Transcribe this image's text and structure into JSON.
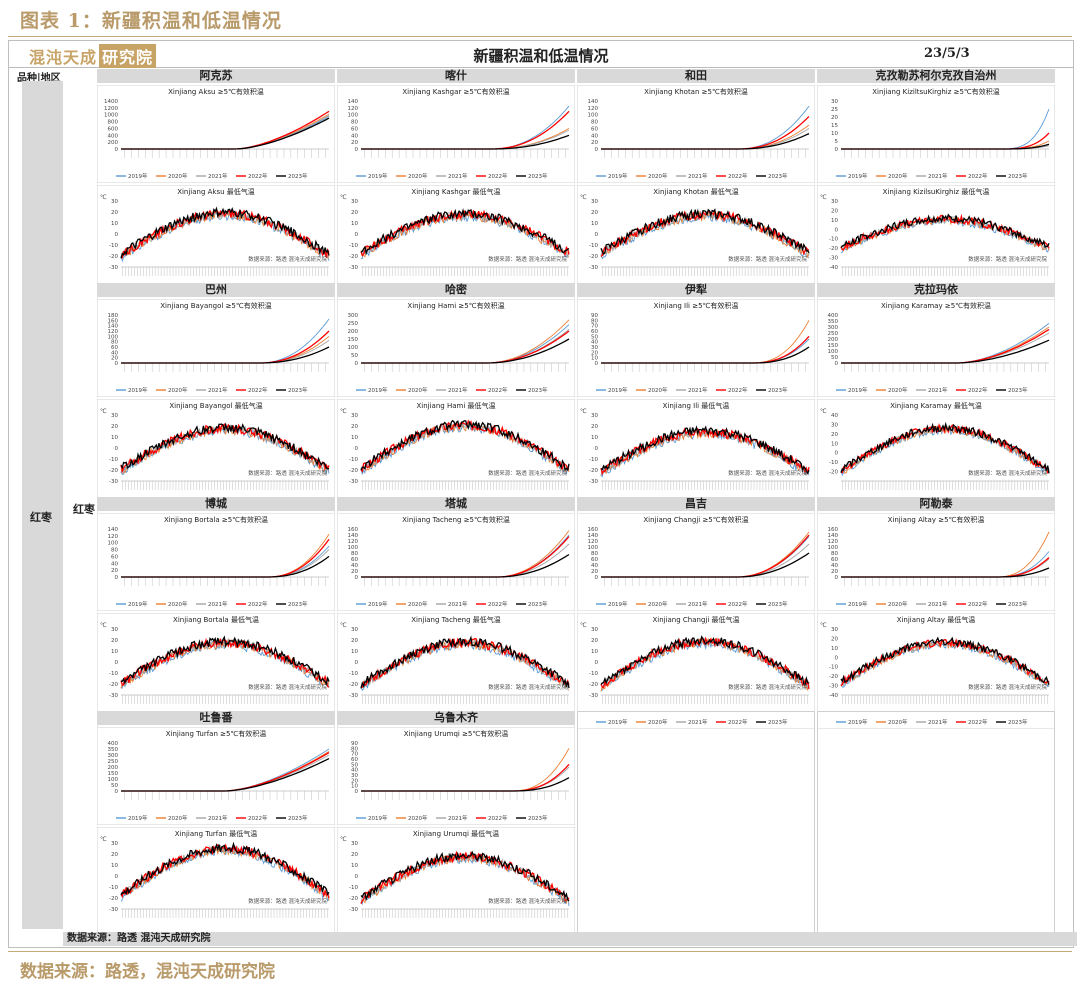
{
  "figure_caption": "图表 1：新疆积温和低温情况",
  "header": {
    "logo_text": "混沌天成",
    "logo_box": "研究院",
    "title": "新疆积温和低温情况",
    "date": "23/5/3",
    "col_header": "品种|地区"
  },
  "left_label": "红枣",
  "left_label2": "红枣",
  "regions": [
    "阿克苏",
    "喀什",
    "和田",
    "克孜勒苏柯尔克孜自治州",
    "巴州",
    "哈密",
    "伊犁",
    "克拉玛依",
    "博城",
    "塔城",
    "昌吉",
    "阿勒泰",
    "吐鲁番",
    "乌鲁木齐"
  ],
  "footer": "数据来源：路透  混沌天成研究院",
  "source_note": "数据来源：路透，混沌天成研究院",
  "colors": {
    "y2019": "#5b9bd5",
    "y2020": "#ed7d31",
    "y2021": "#a5a5a5",
    "y2022": "#ff0000",
    "y2023": "#000000"
  },
  "chart_data": [
    {
      "type": "line",
      "region": "阿克苏",
      "title": "Xinjiang  Aksu  ≥5℃有效积温",
      "y_ticks": [
        "0",
        "200",
        "400",
        "600",
        "800",
        "1000",
        "1200",
        "1400"
      ],
      "ylim": [
        0,
        1400
      ],
      "series": [
        {
          "name": "2019年",
          "end": 950
        },
        {
          "name": "2020年",
          "end": 1020
        },
        {
          "name": "2021年",
          "end": 980
        },
        {
          "name": "2022年",
          "end": 1100
        },
        {
          "name": "2023年",
          "end": 900
        }
      ],
      "start": 0.55,
      "growth": 1.6
    },
    {
      "type": "line",
      "region": "阿克苏",
      "title": "Xinjiang Aksu 最低气温",
      "y_ticks": [
        "-30",
        "-20",
        "-10",
        "0",
        "10",
        "20",
        "30"
      ],
      "ylim": [
        -30,
        30
      ],
      "unit": "℃",
      "note": "数据来源：路透  混沌天成研究院",
      "series": [
        {
          "name": "2019年"
        },
        {
          "name": "2020年"
        },
        {
          "name": "2021年"
        },
        {
          "name": "2022年"
        },
        {
          "name": "2023年"
        }
      ],
      "amp": [
        -20,
        18
      ]
    },
    {
      "type": "line",
      "region": "喀什",
      "title": "Xinjiang  Kashgar  ≥5℃有效积温",
      "y_ticks": [
        "0",
        "20",
        "40",
        "60",
        "80",
        "100",
        "120",
        "140"
      ],
      "ylim": [
        0,
        140
      ],
      "series": [
        {
          "name": "2019年",
          "end": 125
        },
        {
          "name": "2020年",
          "end": 60
        },
        {
          "name": "2021年",
          "end": 55
        },
        {
          "name": "2022年",
          "end": 110
        },
        {
          "name": "2023年",
          "end": 40
        }
      ],
      "start": 0.62,
      "growth": 2.2
    },
    {
      "type": "line",
      "region": "喀什",
      "title": "Xinjiang Kashgar 最低气温",
      "y_ticks": [
        "-30",
        "-20",
        "-10",
        "0",
        "10",
        "20",
        "30"
      ],
      "ylim": [
        -30,
        30
      ],
      "unit": "℃",
      "note": "数据来源：路透  混沌天成研究院",
      "series": [
        {
          "name": "2019年"
        },
        {
          "name": "2020年"
        },
        {
          "name": "2021年"
        },
        {
          "name": "2022年"
        },
        {
          "name": "2023年"
        }
      ],
      "amp": [
        -18,
        17
      ]
    },
    {
      "type": "line",
      "region": "和田",
      "title": "Xinjiang  Khotan  ≥5℃有效积温",
      "y_ticks": [
        "0",
        "20",
        "40",
        "60",
        "80",
        "100",
        "120",
        "140"
      ],
      "ylim": [
        0,
        140
      ],
      "series": [
        {
          "name": "2019年",
          "end": 125
        },
        {
          "name": "2020年",
          "end": 70
        },
        {
          "name": "2021年",
          "end": 60
        },
        {
          "name": "2022年",
          "end": 95
        },
        {
          "name": "2023年",
          "end": 45
        }
      ],
      "start": 0.65,
      "growth": 2.3
    },
    {
      "type": "line",
      "region": "和田",
      "title": "Xinjiang Khotan 最低气温",
      "y_ticks": [
        "-30",
        "-20",
        "-10",
        "0",
        "10",
        "20",
        "30"
      ],
      "ylim": [
        -30,
        30
      ],
      "unit": "℃",
      "note": "数据来源：路透  混沌天成研究院",
      "series": [
        {
          "name": "2019年"
        },
        {
          "name": "2020年"
        },
        {
          "name": "2021年"
        },
        {
          "name": "2022年"
        },
        {
          "name": "2023年"
        }
      ],
      "amp": [
        -18,
        17
      ]
    },
    {
      "type": "line",
      "region": "克孜勒苏柯尔克孜自治州",
      "title": "Xinjiang KiziltsuKirghiz ≥5℃有效积温",
      "y_ticks": [
        "0",
        "5",
        "10",
        "15",
        "20",
        "25",
        "30"
      ],
      "ylim": [
        0,
        30
      ],
      "series": [
        {
          "name": "2019年",
          "end": 25
        },
        {
          "name": "2020年",
          "end": 5
        },
        {
          "name": "2021年",
          "end": 2
        },
        {
          "name": "2022年",
          "end": 10
        },
        {
          "name": "2023年",
          "end": 3
        }
      ],
      "start": 0.75,
      "growth": 3.5
    },
    {
      "type": "line",
      "region": "克孜勒苏柯尔克孜自治州",
      "title": "Xinjiang KizilsuKirghiz 最低气温",
      "y_ticks": [
        "-40",
        "-30",
        "-20",
        "-10",
        "0",
        "10",
        "20",
        "30"
      ],
      "ylim": [
        -40,
        30
      ],
      "unit": "℃",
      "note": "数据来源：路透  混沌天成研究院",
      "series": [
        {
          "name": "2019年"
        },
        {
          "name": "2020年"
        },
        {
          "name": "2021年"
        },
        {
          "name": "2022年"
        },
        {
          "name": "2023年"
        }
      ],
      "amp": [
        -20,
        10
      ]
    },
    {
      "type": "line",
      "region": "巴州",
      "title": "Xinjiang  Bayangol  ≥5℃有效积温",
      "y_ticks": [
        "0",
        "20",
        "40",
        "60",
        "80",
        "100",
        "120",
        "140",
        "160",
        "180"
      ],
      "ylim": [
        0,
        180
      ],
      "series": [
        {
          "name": "2019年",
          "end": 165
        },
        {
          "name": "2020年",
          "end": 100
        },
        {
          "name": "2021年",
          "end": 85
        },
        {
          "name": "2022年",
          "end": 120
        },
        {
          "name": "2023年",
          "end": 60
        }
      ],
      "start": 0.66,
      "growth": 2.2
    },
    {
      "type": "line",
      "region": "巴州",
      "title": "Xinjiang Bayangol 最低气温",
      "y_ticks": [
        "-30",
        "-20",
        "-10",
        "0",
        "10",
        "20",
        "30"
      ],
      "ylim": [
        -30,
        30
      ],
      "unit": "℃",
      "note": "数据来源：路透  混沌天成研究院",
      "series": [
        {
          "name": "2019年"
        },
        {
          "name": "2020年"
        },
        {
          "name": "2021年"
        },
        {
          "name": "2022年"
        },
        {
          "name": "2023年"
        }
      ],
      "amp": [
        -20,
        17
      ]
    },
    {
      "type": "line",
      "region": "哈密",
      "title": "Xinjiang  Hami  ≥5℃有效积温",
      "y_ticks": [
        "0",
        "50",
        "100",
        "150",
        "200",
        "250",
        "300"
      ],
      "ylim": [
        0,
        300
      ],
      "series": [
        {
          "name": "2019年",
          "end": 240
        },
        {
          "name": "2020年",
          "end": 270
        },
        {
          "name": "2021年",
          "end": 210
        },
        {
          "name": "2022年",
          "end": 200
        },
        {
          "name": "2023年",
          "end": 150
        }
      ],
      "start": 0.6,
      "growth": 2.0
    },
    {
      "type": "line",
      "region": "哈密",
      "title": "Xinjiang Hami 最低气温",
      "y_ticks": [
        "-30",
        "-20",
        "-10",
        "0",
        "10",
        "20",
        "30"
      ],
      "ylim": [
        -30,
        30
      ],
      "unit": "℃",
      "note": "数据来源：路透  混沌天成研究院",
      "series": [
        {
          "name": "2019年"
        },
        {
          "name": "2020年"
        },
        {
          "name": "2021年"
        },
        {
          "name": "2022年"
        },
        {
          "name": "2023年"
        }
      ],
      "amp": [
        -20,
        20
      ]
    },
    {
      "type": "line",
      "region": "伊犁",
      "title": "Xinjiang  Ili  ≥5℃有效积温",
      "y_ticks": [
        "0",
        "10",
        "20",
        "30",
        "40",
        "50",
        "60",
        "70",
        "80",
        "90"
      ],
      "ylim": [
        0,
        90
      ],
      "series": [
        {
          "name": "2019年",
          "end": 45
        },
        {
          "name": "2020年",
          "end": 80
        },
        {
          "name": "2021年",
          "end": 30
        },
        {
          "name": "2022年",
          "end": 50
        },
        {
          "name": "2023年",
          "end": 30
        }
      ],
      "start": 0.72,
      "growth": 2.5
    },
    {
      "type": "line",
      "region": "伊犁",
      "title": "Xinjiang Ili 最低气温",
      "y_ticks": [
        "-30",
        "-20",
        "-10",
        "0",
        "10",
        "20",
        "30"
      ],
      "ylim": [
        -30,
        30
      ],
      "unit": "℃",
      "note": "数据来源：路透  混沌天成研究院",
      "series": [
        {
          "name": "2019年"
        },
        {
          "name": "2020年"
        },
        {
          "name": "2021年"
        },
        {
          "name": "2022年"
        },
        {
          "name": "2023年"
        }
      ],
      "amp": [
        -22,
        14
      ]
    },
    {
      "type": "line",
      "region": "克拉玛依",
      "title": "Xinjiang  Karamay  ≥5℃有效积温",
      "y_ticks": [
        "0",
        "50",
        "100",
        "150",
        "200",
        "250",
        "300",
        "350",
        "400"
      ],
      "ylim": [
        0,
        400
      ],
      "series": [
        {
          "name": "2019年",
          "end": 330
        },
        {
          "name": "2020年",
          "end": 300
        },
        {
          "name": "2021年",
          "end": 250
        },
        {
          "name": "2022年",
          "end": 280
        },
        {
          "name": "2023年",
          "end": 190
        }
      ],
      "start": 0.55,
      "growth": 1.8
    },
    {
      "type": "line",
      "region": "克拉玛依",
      "title": "Xinjiang Karamay 最低气温",
      "y_ticks": [
        "-20",
        "-10",
        "0",
        "10",
        "20",
        "30",
        "40"
      ],
      "ylim": [
        -30,
        40
      ],
      "unit": "℃",
      "note": "数据来源：路透  混沌天成研究院",
      "series": [
        {
          "name": "2019年"
        },
        {
          "name": "2020年"
        },
        {
          "name": "2021年"
        },
        {
          "name": "2022年"
        },
        {
          "name": "2023年"
        }
      ],
      "amp": [
        -20,
        25
      ]
    },
    {
      "type": "line",
      "region": "博城",
      "title": "Xinjiang  Bortala  ≥5℃有效积温",
      "y_ticks": [
        "0",
        "20",
        "40",
        "60",
        "80",
        "100",
        "120",
        "140"
      ],
      "ylim": [
        0,
        140
      ],
      "series": [
        {
          "name": "2019年",
          "end": 90
        },
        {
          "name": "2020年",
          "end": 125
        },
        {
          "name": "2021年",
          "end": 80
        },
        {
          "name": "2022年",
          "end": 110
        },
        {
          "name": "2023年",
          "end": 60
        }
      ],
      "start": 0.7,
      "growth": 2.3
    },
    {
      "type": "line",
      "region": "博城",
      "title": "Xinjiang Bortala 最低气温",
      "y_ticks": [
        "-30",
        "-20",
        "-10",
        "0",
        "10",
        "20",
        "30"
      ],
      "ylim": [
        -30,
        30
      ],
      "unit": "℃",
      "note": "数据来源：路透  混沌天成研究院",
      "series": [
        {
          "name": "2019年"
        },
        {
          "name": "2020年"
        },
        {
          "name": "2021年"
        },
        {
          "name": "2022年"
        },
        {
          "name": "2023年"
        }
      ],
      "amp": [
        -20,
        17
      ]
    },
    {
      "type": "line",
      "region": "塔城",
      "title": "Xinjiang Tacheng ≥5℃有效积温",
      "y_ticks": [
        "0",
        "20",
        "40",
        "60",
        "80",
        "100",
        "120",
        "140",
        "160"
      ],
      "ylim": [
        0,
        160
      ],
      "series": [
        {
          "name": "2019年",
          "end": 140
        },
        {
          "name": "2020年",
          "end": 155
        },
        {
          "name": "2021年",
          "end": 110
        },
        {
          "name": "2022年",
          "end": 135
        },
        {
          "name": "2023年",
          "end": 75
        }
      ],
      "start": 0.65,
      "growth": 2.1
    },
    {
      "type": "line",
      "region": "塔城",
      "title": "Xinjiang Tacheng 最低气温",
      "y_ticks": [
        "-30",
        "-20",
        "-10",
        "0",
        "10",
        "20",
        "30"
      ],
      "ylim": [
        -30,
        30
      ],
      "unit": "℃",
      "note": "数据来源：路透  混沌天成研究院",
      "series": [
        {
          "name": "2019年"
        },
        {
          "name": "2020年"
        },
        {
          "name": "2021年"
        },
        {
          "name": "2022年"
        },
        {
          "name": "2023年"
        }
      ],
      "amp": [
        -22,
        17
      ]
    },
    {
      "type": "line",
      "region": "昌吉",
      "title": "Xinjiang  Changji  ≥5℃有效积温",
      "y_ticks": [
        "0",
        "20",
        "40",
        "60",
        "80",
        "100",
        "120",
        "140",
        "160"
      ],
      "ylim": [
        0,
        160
      ],
      "series": [
        {
          "name": "2019年",
          "end": 135
        },
        {
          "name": "2020年",
          "end": 150
        },
        {
          "name": "2021年",
          "end": 110
        },
        {
          "name": "2022年",
          "end": 140
        },
        {
          "name": "2023年",
          "end": 80
        }
      ],
      "start": 0.65,
      "growth": 2.1
    },
    {
      "type": "line",
      "region": "昌吉",
      "title": "Xinjiang Changji 最低气温",
      "y_ticks": [
        "-30",
        "-20",
        "-10",
        "0",
        "10",
        "20",
        "30"
      ],
      "ylim": [
        -30,
        30
      ],
      "unit": "℃",
      "note": "数据来源：路透  混沌天成研究院",
      "series": [
        {
          "name": "2019年"
        },
        {
          "name": "2020年"
        },
        {
          "name": "2021年"
        },
        {
          "name": "2022年"
        },
        {
          "name": "2023年"
        }
      ],
      "amp": [
        -22,
        18
      ]
    },
    {
      "type": "line",
      "region": "阿勒泰",
      "title": "Xinjiang  Altay  ≥5℃有效积温",
      "y_ticks": [
        "0",
        "20",
        "40",
        "60",
        "80",
        "100",
        "120",
        "140",
        "160"
      ],
      "ylim": [
        0,
        160
      ],
      "series": [
        {
          "name": "2019年",
          "end": 85
        },
        {
          "name": "2020年",
          "end": 150
        },
        {
          "name": "2021年",
          "end": 60
        },
        {
          "name": "2022年",
          "end": 65
        },
        {
          "name": "2023年",
          "end": 30
        }
      ],
      "start": 0.74,
      "growth": 2.6
    },
    {
      "type": "line",
      "region": "阿勒泰",
      "title": "Xinjiang Altay 最低气温",
      "y_ticks": [
        "-40",
        "-30",
        "-20",
        "-10",
        "0",
        "10",
        "20",
        "30"
      ],
      "ylim": [
        -40,
        30
      ],
      "unit": "℃",
      "note": "数据来源：路透  混沌天成研究院",
      "series": [
        {
          "name": "2019年"
        },
        {
          "name": "2020年"
        },
        {
          "name": "2021年"
        },
        {
          "name": "2022年"
        },
        {
          "name": "2023年"
        }
      ],
      "amp": [
        -28,
        15
      ]
    },
    {
      "type": "line",
      "region": "吐鲁番",
      "title": "Xinjiang Turfan ≥5℃有效积温",
      "y_ticks": [
        "0",
        "50",
        "100",
        "150",
        "200",
        "250",
        "300",
        "350",
        "400"
      ],
      "ylim": [
        0,
        400
      ],
      "series": [
        {
          "name": "2019年",
          "end": 350
        },
        {
          "name": "2020年",
          "end": 330
        },
        {
          "name": "2021年",
          "end": 300
        },
        {
          "name": "2022年",
          "end": 320
        },
        {
          "name": "2023年",
          "end": 270
        }
      ],
      "start": 0.5,
      "growth": 1.6
    },
    {
      "type": "line",
      "region": "吐鲁番",
      "title": "Xinjiang Turfan 最低气温",
      "y_ticks": [
        "-30",
        "-20",
        "-10",
        "0",
        "10",
        "20",
        "30"
      ],
      "ylim": [
        -30,
        30
      ],
      "unit": "℃",
      "note": "数据来源：路透  混沌天成研究院",
      "series": [
        {
          "name": "2019年"
        },
        {
          "name": "2020年"
        },
        {
          "name": "2021年"
        },
        {
          "name": "2022年"
        },
        {
          "name": "2023年"
        }
      ],
      "amp": [
        -18,
        24
      ]
    },
    {
      "type": "line",
      "region": "乌鲁木齐",
      "title": "Xinjiang Urumqi ≥5℃有效积温",
      "y_ticks": [
        "0",
        "10",
        "20",
        "30",
        "40",
        "50",
        "60",
        "70",
        "80",
        "90"
      ],
      "ylim": [
        0,
        90
      ],
      "series": [
        {
          "name": "2019年",
          "end": 50
        },
        {
          "name": "2020年",
          "end": 80
        },
        {
          "name": "2021年",
          "end": 45
        },
        {
          "name": "2022年",
          "end": 50
        },
        {
          "name": "2023年",
          "end": 25
        }
      ],
      "start": 0.72,
      "growth": 2.5
    },
    {
      "type": "line",
      "region": "乌鲁木齐",
      "title": "Xinjiang Urumqi 最低气温",
      "y_ticks": [
        "-30",
        "-20",
        "-10",
        "0",
        "10",
        "20",
        "30"
      ],
      "ylim": [
        -30,
        30
      ],
      "unit": "℃",
      "note": "数据来源：路透  混沌天成研究院",
      "series": [
        {
          "name": "2019年"
        },
        {
          "name": "2020年"
        },
        {
          "name": "2021年"
        },
        {
          "name": "2022年"
        },
        {
          "name": "2023年"
        }
      ],
      "amp": [
        -22,
        17
      ]
    }
  ]
}
